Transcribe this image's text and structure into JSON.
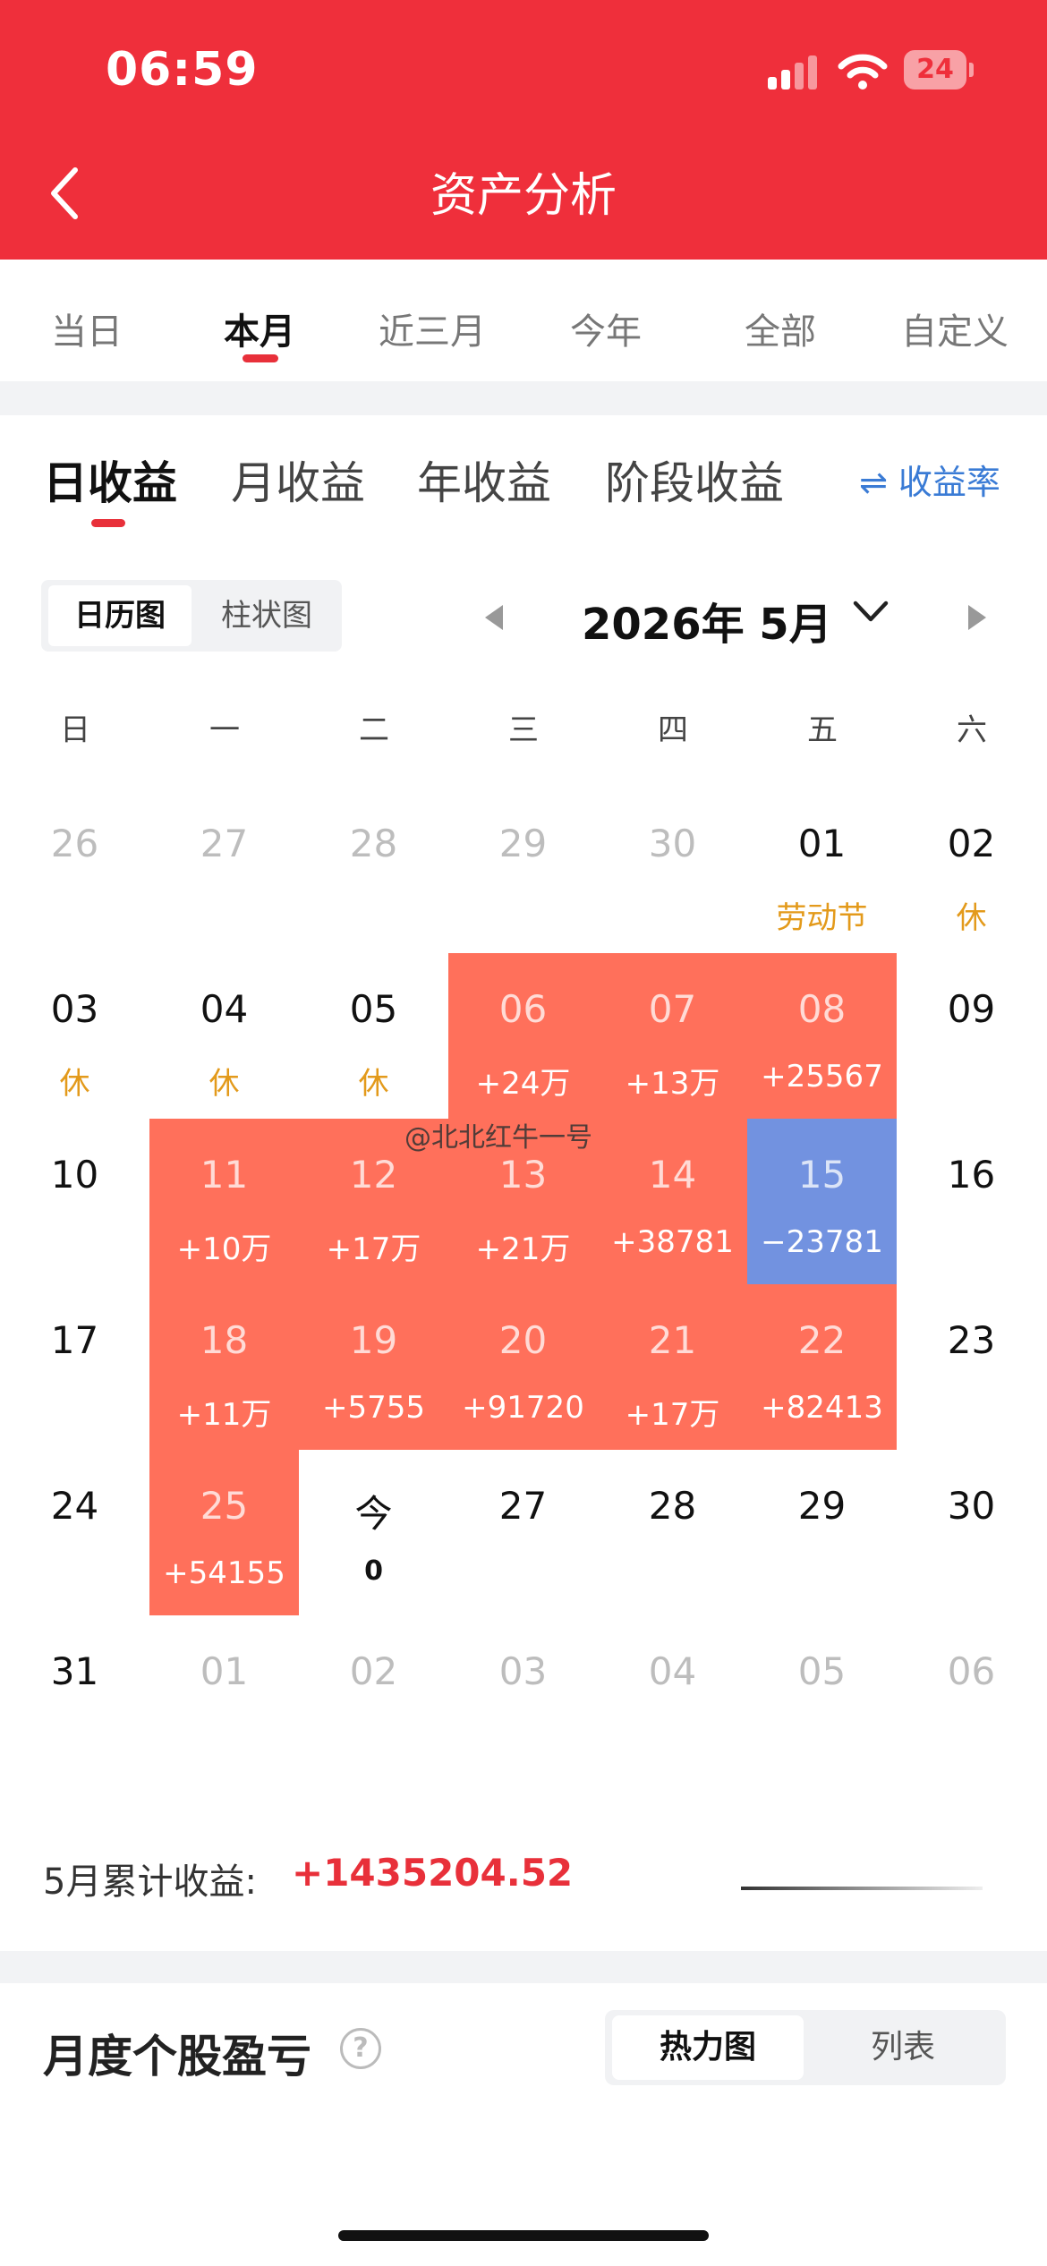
{
  "status": {
    "time": "06:59",
    "battery": "24"
  },
  "header": {
    "title": "资产分析"
  },
  "period_tabs": [
    "当日",
    "本月",
    "近三月",
    "今年",
    "全部",
    "自定义"
  ],
  "profit_tabs": [
    "日收益",
    "月收益",
    "年收益",
    "阶段收益"
  ],
  "rate_toggle": "⇌ 收益率",
  "view_toggle": [
    "日历图",
    "柱状图"
  ],
  "month_label": "2026年 5月",
  "weekdays": [
    "日",
    "一",
    "二",
    "三",
    "四",
    "五",
    "六"
  ],
  "calendar": [
    [
      {
        "d": "26",
        "o": 1
      },
      {
        "d": "27",
        "o": 1
      },
      {
        "d": "28",
        "o": 1
      },
      {
        "d": "29",
        "o": 1
      },
      {
        "d": "30",
        "o": 1
      },
      {
        "d": "01",
        "s": "劳动节",
        "k": "hol"
      },
      {
        "d": "02",
        "s": "休",
        "k": "hol"
      }
    ],
    [
      {
        "d": "03",
        "s": "休",
        "k": "hol"
      },
      {
        "d": "04",
        "s": "休",
        "k": "hol"
      },
      {
        "d": "05",
        "s": "休",
        "k": "hol"
      },
      {
        "d": "06",
        "s": "+24万",
        "k": "pos"
      },
      {
        "d": "07",
        "s": "+13万",
        "k": "pos"
      },
      {
        "d": "08",
        "s": "+25567",
        "k": "pos"
      },
      {
        "d": "09"
      }
    ],
    [
      {
        "d": "10"
      },
      {
        "d": "11",
        "s": "+10万",
        "k": "pos"
      },
      {
        "d": "12",
        "s": "+17万",
        "k": "pos"
      },
      {
        "d": "13",
        "s": "+21万",
        "k": "pos"
      },
      {
        "d": "14",
        "s": "+38781",
        "k": "pos"
      },
      {
        "d": "15",
        "s": "−23781",
        "k": "neg"
      },
      {
        "d": "16"
      }
    ],
    [
      {
        "d": "17"
      },
      {
        "d": "18",
        "s": "+11万",
        "k": "pos"
      },
      {
        "d": "19",
        "s": "+5755",
        "k": "pos"
      },
      {
        "d": "20",
        "s": "+91720",
        "k": "pos"
      },
      {
        "d": "21",
        "s": "+17万",
        "k": "pos"
      },
      {
        "d": "22",
        "s": "+82413",
        "k": "pos"
      },
      {
        "d": "23"
      }
    ],
    [
      {
        "d": "24"
      },
      {
        "d": "25",
        "s": "+54155",
        "k": "pos"
      },
      {
        "d": "今",
        "s": "0",
        "k": "zero"
      },
      {
        "d": "27"
      },
      {
        "d": "28"
      },
      {
        "d": "29"
      },
      {
        "d": "30"
      }
    ],
    [
      {
        "d": "31"
      },
      {
        "d": "01",
        "o": 1
      },
      {
        "d": "02",
        "o": 1
      },
      {
        "d": "03",
        "o": 1
      },
      {
        "d": "04",
        "o": 1
      },
      {
        "d": "05",
        "o": 1
      },
      {
        "d": "06",
        "o": 1
      }
    ]
  ],
  "watermark": "@北北红牛一号",
  "cumulative": {
    "label": "5月累计收益:",
    "value": "+1435204.52"
  },
  "stock_section": {
    "title": "月度个股盈亏",
    "help": "?",
    "views": [
      "热力图",
      "列表"
    ]
  },
  "colors": {
    "header": "#EF2F3B",
    "gain": "#FF705B",
    "loss": "#7292E0",
    "holiday": "#E39A1B",
    "accent_red": "#E8303A",
    "link_blue": "#3A7BD5"
  }
}
